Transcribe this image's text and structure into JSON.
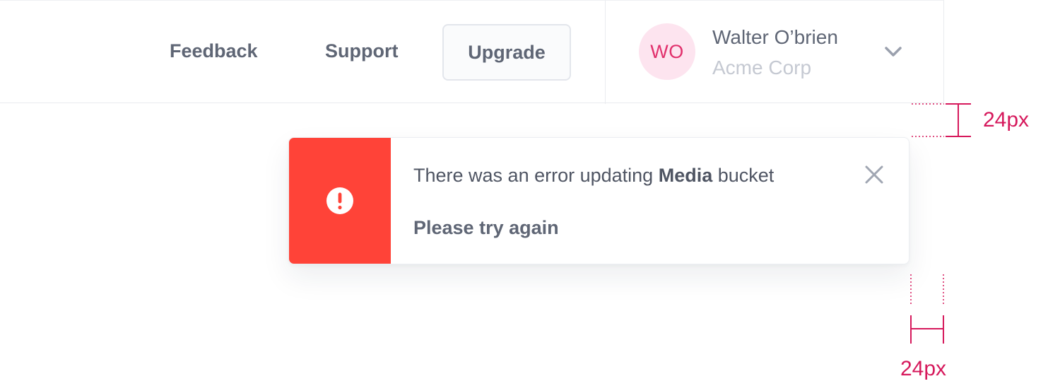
{
  "header": {
    "nav": {
      "feedback": "Feedback",
      "support": "Support",
      "upgrade": "Upgrade"
    },
    "user": {
      "initials": "WO",
      "name": "Walter O’brien",
      "company": "Acme Corp",
      "menu_icon": "chevron-down-icon"
    }
  },
  "toast": {
    "type": "error",
    "icon": "exclamation-circle-icon",
    "message_prefix": "There was an error updating ",
    "message_bold": "Media",
    "message_suffix": " bucket",
    "subtext": "Please try again",
    "close_icon": "close-icon"
  },
  "annotations": {
    "vertical_spacing": "24px",
    "horizontal_spacing": "24px"
  },
  "colors": {
    "error": "#ff4338",
    "annotation": "#d6195c",
    "avatar_bg": "#fde4ef",
    "avatar_text": "#e1306c",
    "text": "#5f6675",
    "muted": "#c5c9d2"
  }
}
